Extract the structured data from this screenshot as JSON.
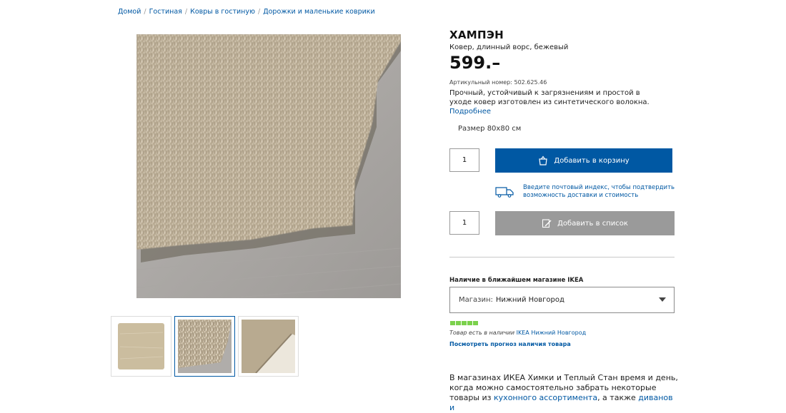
{
  "breadcrumb": {
    "items": [
      "Домой",
      "Гостиная",
      "Ковры в гостиную",
      "Дорожки и маленькие коврики"
    ],
    "separator": "/"
  },
  "product": {
    "name": "ХАМПЭН",
    "subtitle": "Ковер, длинный ворс, бежевый",
    "price": "599.–",
    "article_number": "Артикульный номер: 502.625.46",
    "description": "Прочный, устойчивый к загрязнениям и простой в уходе ковер изготовлен из синтетического волокна.",
    "more_link": "Подробнее",
    "size": "Размер 80x80 см"
  },
  "cart": {
    "quantity": "1",
    "add_to_cart_label": "Добавить в корзину",
    "delivery_text": "Введите почтовый индекс, чтобы подтвердить возможность доставки и стоимость"
  },
  "list": {
    "quantity": "1",
    "add_to_list_label": "Добавить в список"
  },
  "availability": {
    "title": "Наличие в ближайшем магазине IKEA",
    "store_label": "Магазин:",
    "store_value": "Нижний Новгород",
    "stock_text": "Товар есть в наличии",
    "stock_store_link": "IKEA Нижний Новгород",
    "forecast_link": "Посмотреть прогноз наличия товара",
    "stock_level": 1.0
  },
  "promo": {
    "text1": "В магазинах ИКЕА Химки и Теплый Стан время и день, когда можно самостоятельно забрать некоторые товары из ",
    "link1": "кухонного ассортимента",
    "text2": ", а также ",
    "link2": "диванов и"
  },
  "colors": {
    "accent_blue": "#0058a3",
    "list_button_gray": "#9a9a9a",
    "stock_green": "#7bd14c"
  },
  "icons": {
    "cart": "shopping-bag-icon",
    "list": "pencil-list-icon",
    "delivery": "delivery-truck-icon",
    "chevron": "chevron-down-icon"
  }
}
